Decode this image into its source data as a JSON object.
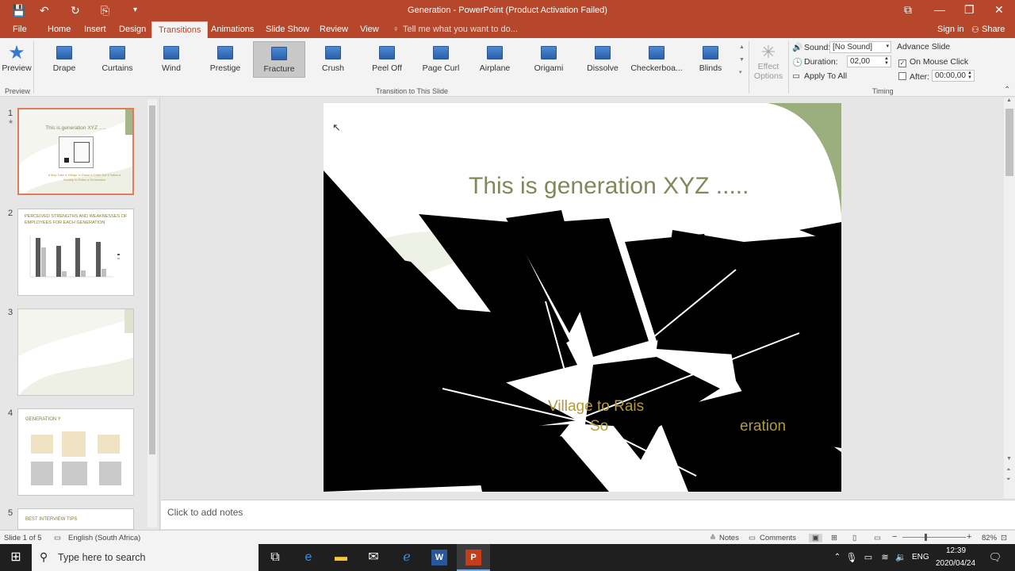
{
  "titlebar": {
    "title": "Generation - PowerPoint (Product Activation Failed)",
    "save_icon": "💾",
    "undo_icon": "↶",
    "redo_icon": "↻",
    "present_icon": "⎘",
    "customize_icon": "▾",
    "ribbon_display_icon": "⧉",
    "minimize_icon": "—",
    "restore_icon": "❐",
    "close_icon": "✕"
  },
  "tabs": {
    "file": "File",
    "home": "Home",
    "insert": "Insert",
    "design": "Design",
    "transitions": "Transitions",
    "animations": "Animations",
    "slideshow": "Slide Show",
    "review": "Review",
    "view": "View",
    "tellme": "Tell me what you want to do...",
    "signin": "Sign in",
    "share": "Share"
  },
  "ribbon": {
    "preview_label": "Preview",
    "preview_group": "Preview",
    "transitions": [
      "Drape",
      "Curtains",
      "Wind",
      "Prestige",
      "Fracture",
      "Crush",
      "Peel Off",
      "Page Curl",
      "Airplane",
      "Origami",
      "Dissolve",
      "Checkerboa...",
      "Blinds"
    ],
    "selected_transition": "Fracture",
    "transition_group": "Transition to This Slide",
    "effect_options": "Effect Options",
    "sound_label": "Sound:",
    "sound_value": "[No Sound]",
    "duration_label": "Duration:",
    "duration_value": "02,00",
    "apply_all": "Apply To All",
    "advance_slide": "Advance Slide",
    "on_mouse_click": "On Mouse Click",
    "after_label": "After:",
    "after_value": "00:00,00",
    "timing_group": "Timing"
  },
  "slides": {
    "numbers": [
      "1",
      "2",
      "3",
      "4",
      "5"
    ],
    "s1_title": "This is generation XYZ .....",
    "s1_subtitle": "It May Take a Village to Raise a Child, but it Takes a Society to Raise a Generation",
    "s2_title": "PERCEIVED STRENGTHS AND WEAKNESSES OF EMPLOYEES FOR EACH GENERATION",
    "s4_title": "GENERATION Y",
    "s5_title": "BEST INTERVIEW TIPS"
  },
  "main_slide": {
    "title": "This is generation XYZ .....",
    "sub_fragment_1": "Village to Rais",
    "sub_fragment_2": "So",
    "sub_fragment_3": "eration"
  },
  "notes": {
    "placeholder": "Click to add notes"
  },
  "status": {
    "slide_info": "Slide 1 of 5",
    "language": "English (South Africa)",
    "notes": "Notes",
    "comments": "Comments",
    "zoom": "82%"
  },
  "taskbar": {
    "search_placeholder": "Type here to search",
    "lang": "ENG",
    "time": "12:39",
    "date": "2020/04/24"
  }
}
